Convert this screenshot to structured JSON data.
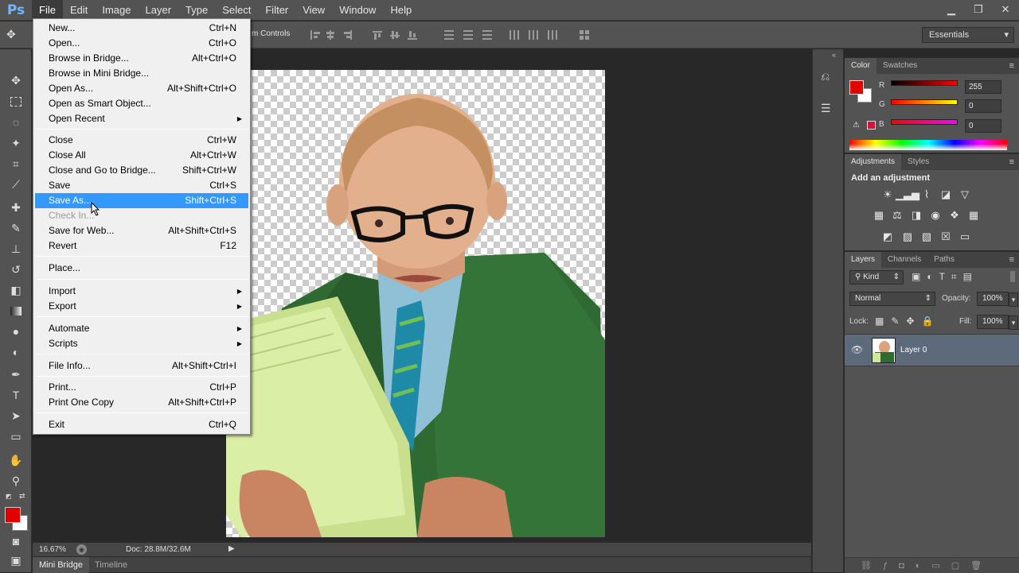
{
  "app": {
    "logo": "Ps"
  },
  "menubar": {
    "items": [
      "File",
      "Edit",
      "Image",
      "Layer",
      "Type",
      "Select",
      "Filter",
      "View",
      "Window",
      "Help"
    ]
  },
  "window_controls": {
    "minimize": "▁",
    "restore": "❐",
    "close": "✕"
  },
  "options_bar": {
    "transform_controls_label": "m Controls",
    "workspace": "Essentials"
  },
  "file_menu": {
    "items": [
      {
        "label": "New...",
        "shortcut": "Ctrl+N"
      },
      {
        "label": "Open...",
        "shortcut": "Ctrl+O"
      },
      {
        "label": "Browse in Bridge...",
        "shortcut": "Alt+Ctrl+O"
      },
      {
        "label": "Browse in Mini Bridge...",
        "shortcut": ""
      },
      {
        "label": "Open As...",
        "shortcut": "Alt+Shift+Ctrl+O"
      },
      {
        "label": "Open as Smart Object...",
        "shortcut": ""
      },
      {
        "label": "Open Recent",
        "shortcut": ""
      },
      {
        "label": "Close",
        "shortcut": "Ctrl+W"
      },
      {
        "label": "Close All",
        "shortcut": "Alt+Ctrl+W"
      },
      {
        "label": "Close and Go to Bridge...",
        "shortcut": "Shift+Ctrl+W"
      },
      {
        "label": "Save",
        "shortcut": "Ctrl+S"
      },
      {
        "label": "Save As...",
        "shortcut": "Shift+Ctrl+S"
      },
      {
        "label": "Check In...",
        "shortcut": ""
      },
      {
        "label": "Save for Web...",
        "shortcut": "Alt+Shift+Ctrl+S"
      },
      {
        "label": "Revert",
        "shortcut": "F12"
      },
      {
        "label": "Place...",
        "shortcut": ""
      },
      {
        "label": "Import",
        "shortcut": ""
      },
      {
        "label": "Export",
        "shortcut": ""
      },
      {
        "label": "Automate",
        "shortcut": ""
      },
      {
        "label": "Scripts",
        "shortcut": ""
      },
      {
        "label": "File Info...",
        "shortcut": "Alt+Shift+Ctrl+I"
      },
      {
        "label": "Print...",
        "shortcut": "Ctrl+P"
      },
      {
        "label": "Print One Copy",
        "shortcut": "Alt+Shift+Ctrl+P"
      },
      {
        "label": "Exit",
        "shortcut": "Ctrl+Q"
      }
    ],
    "selected": "Save As...",
    "disabled": "Check In..."
  },
  "status_bar": {
    "zoom": "16.67%",
    "doc": "Doc: 28.8M/32.6M"
  },
  "bottom_tabs": {
    "mini_bridge": "Mini Bridge",
    "timeline": "Timeline"
  },
  "color_panel": {
    "tabs": [
      "Color",
      "Swatches"
    ],
    "foreground": "#e00000",
    "background": "#ffffff",
    "channels": [
      {
        "label": "R",
        "value": "255"
      },
      {
        "label": "G",
        "value": "0"
      },
      {
        "label": "B",
        "value": "0"
      }
    ]
  },
  "adjustments_panel": {
    "tabs": [
      "Adjustments",
      "Styles"
    ],
    "heading": "Add an adjustment"
  },
  "layers_panel": {
    "tabs": [
      "Layers",
      "Channels",
      "Paths"
    ],
    "filter_kind": "Kind",
    "blend_mode": "Normal",
    "opacity_label": "Opacity:",
    "opacity": "100%",
    "lock_label": "Lock:",
    "fill_label": "Fill:",
    "fill": "100%",
    "layers": [
      {
        "name": "Layer 0",
        "visible": true
      }
    ]
  },
  "colors": {
    "accent": "#3399ff",
    "panel": "#535353",
    "chrome": "#282828"
  }
}
